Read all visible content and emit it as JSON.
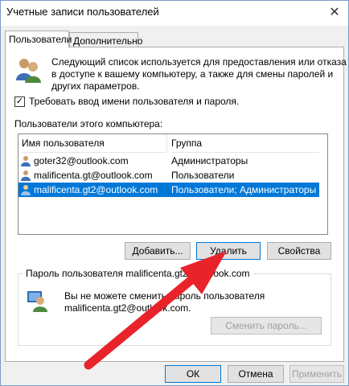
{
  "window": {
    "title": "Учетные записи пользователей",
    "close_glyph": "✕"
  },
  "tabs": [
    {
      "label": "Пользователи",
      "active": true
    },
    {
      "label": "Дополнительно",
      "active": false
    }
  ],
  "intro": {
    "line1": "Следующий список используется для предоставления или отказа",
    "line2": "в доступе к вашему компьютеру, а также для смены паролей и",
    "line3": "других параметров."
  },
  "require_login": {
    "label": "Требовать ввод имени пользователя и пароля.",
    "checked": true,
    "glyph": "✓"
  },
  "users_section": {
    "label": "Пользователи этого компьютера:",
    "columns": [
      "Имя пользователя",
      "Группа"
    ],
    "rows": [
      {
        "name": "goter32@outlook.com",
        "group": "Администраторы",
        "selected": false
      },
      {
        "name": "malificenta.gt@outlook.com",
        "group": "Пользователи",
        "selected": false
      },
      {
        "name": "malificenta.gt2@outlook.com",
        "group": "Пользователи; Администраторы",
        "selected": true
      }
    ]
  },
  "buttons": {
    "add": "Добавить...",
    "remove": "Удалить",
    "properties": "Свойства"
  },
  "password_group": {
    "legend": "Пароль пользователя malificenta.gt2@outlook.com",
    "message_line1": "Вы не можете сменить пароль пользователя",
    "message_line2": "malificenta.gt2@outlook.com.",
    "change_button": "Сменить пароль..."
  },
  "footer": {
    "ok": "ОК",
    "cancel": "Отмена",
    "apply": "Применить"
  },
  "colors": {
    "selection": "#0078d7",
    "arrow": "#e8232a"
  }
}
